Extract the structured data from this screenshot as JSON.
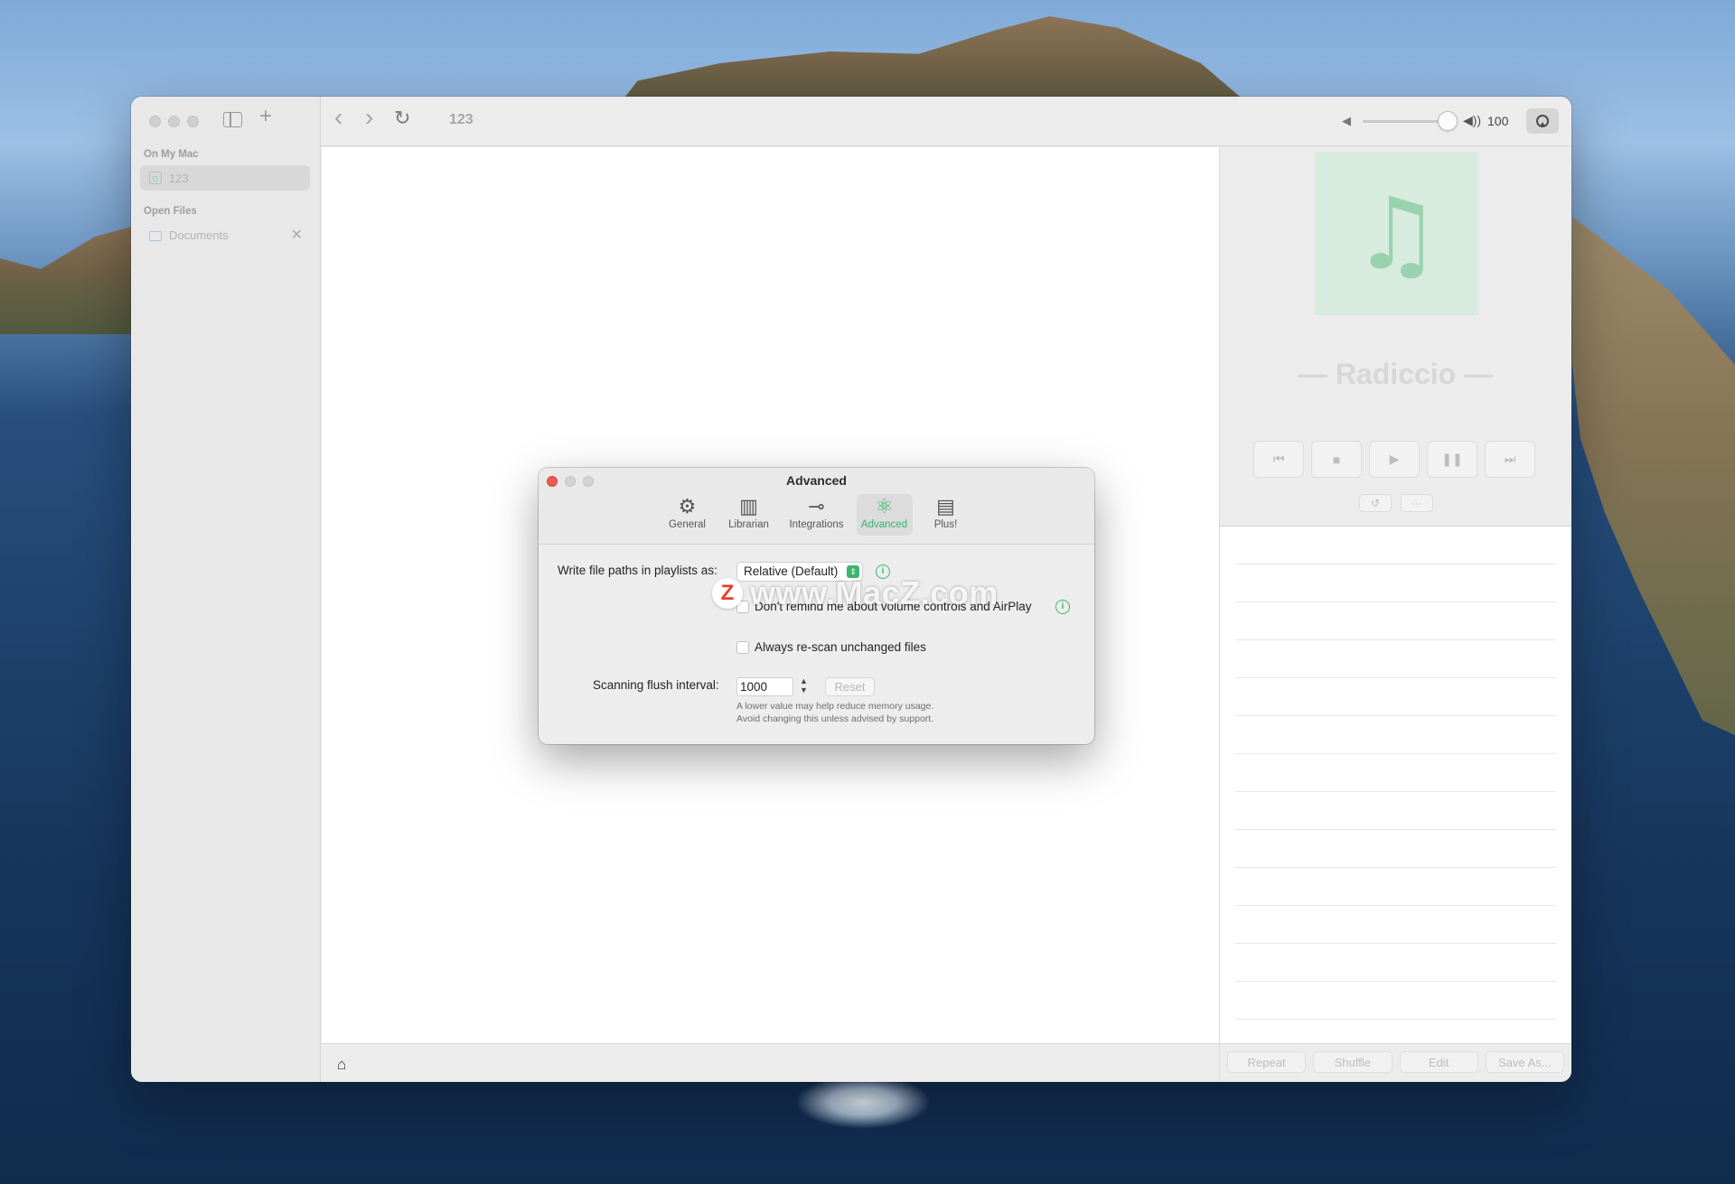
{
  "sidebar": {
    "section_mac": "On My Mac",
    "item_123": "123",
    "section_open": "Open Files",
    "item_documents": "Documents",
    "close_glyph": "✕",
    "add_glyph": "+"
  },
  "toolbar": {
    "back_glyph": "‹",
    "forward_glyph": "›",
    "reload_glyph": "↻",
    "title": "123",
    "volume_low_glyph": "◀",
    "volume_high_glyph": "◀))",
    "volume_value": "100",
    "volume_level": 1.0
  },
  "player": {
    "note_glyph": "♫",
    "track_name": "— Radiccio —",
    "controls": {
      "previous": "⏮",
      "stop": "■",
      "play": "▶",
      "pause": "❚❚",
      "next": "⏭"
    },
    "repeat_glyph": "↺",
    "more_glyph": "···"
  },
  "playlist": {
    "buttons": {
      "repeat": "Repeat",
      "shuffle": "Shuffle",
      "edit": "Edit",
      "save_as": "Save As..."
    }
  },
  "bottombar": {
    "home_glyph": "⌂"
  },
  "dialog": {
    "title": "Advanced",
    "tabs": {
      "general": "General",
      "librarian": "Librarian",
      "integrations": "Integrations",
      "advanced": "Advanced",
      "plus": "Plus!"
    },
    "tab_icons": {
      "general": "⚙",
      "librarian": "▥",
      "integrations": "⊸",
      "advanced": "⚛",
      "plus": "▤"
    },
    "write_paths_label": "Write file paths in playlists as:",
    "write_paths_value": "Relative (Default)",
    "popup_arrows": "⇕",
    "info_glyph": "i",
    "volume_reminder_label": "Don't remind me about volume controls and AirPlay",
    "rescan_label": "Always re-scan unchanged files",
    "flush_label": "Scanning flush interval:",
    "flush_value": "1000",
    "stepper_up": "▲",
    "stepper_down": "▼",
    "reset_label": "Reset",
    "help_line1": "A lower value may help reduce memory usage.",
    "help_line2": "Avoid changing this unless advised by support."
  },
  "watermark": {
    "badge": "Z",
    "text": "www.MacZ.com"
  },
  "colors": {
    "accent_green": "#3cb56e",
    "close_red": "#ee5b51"
  }
}
